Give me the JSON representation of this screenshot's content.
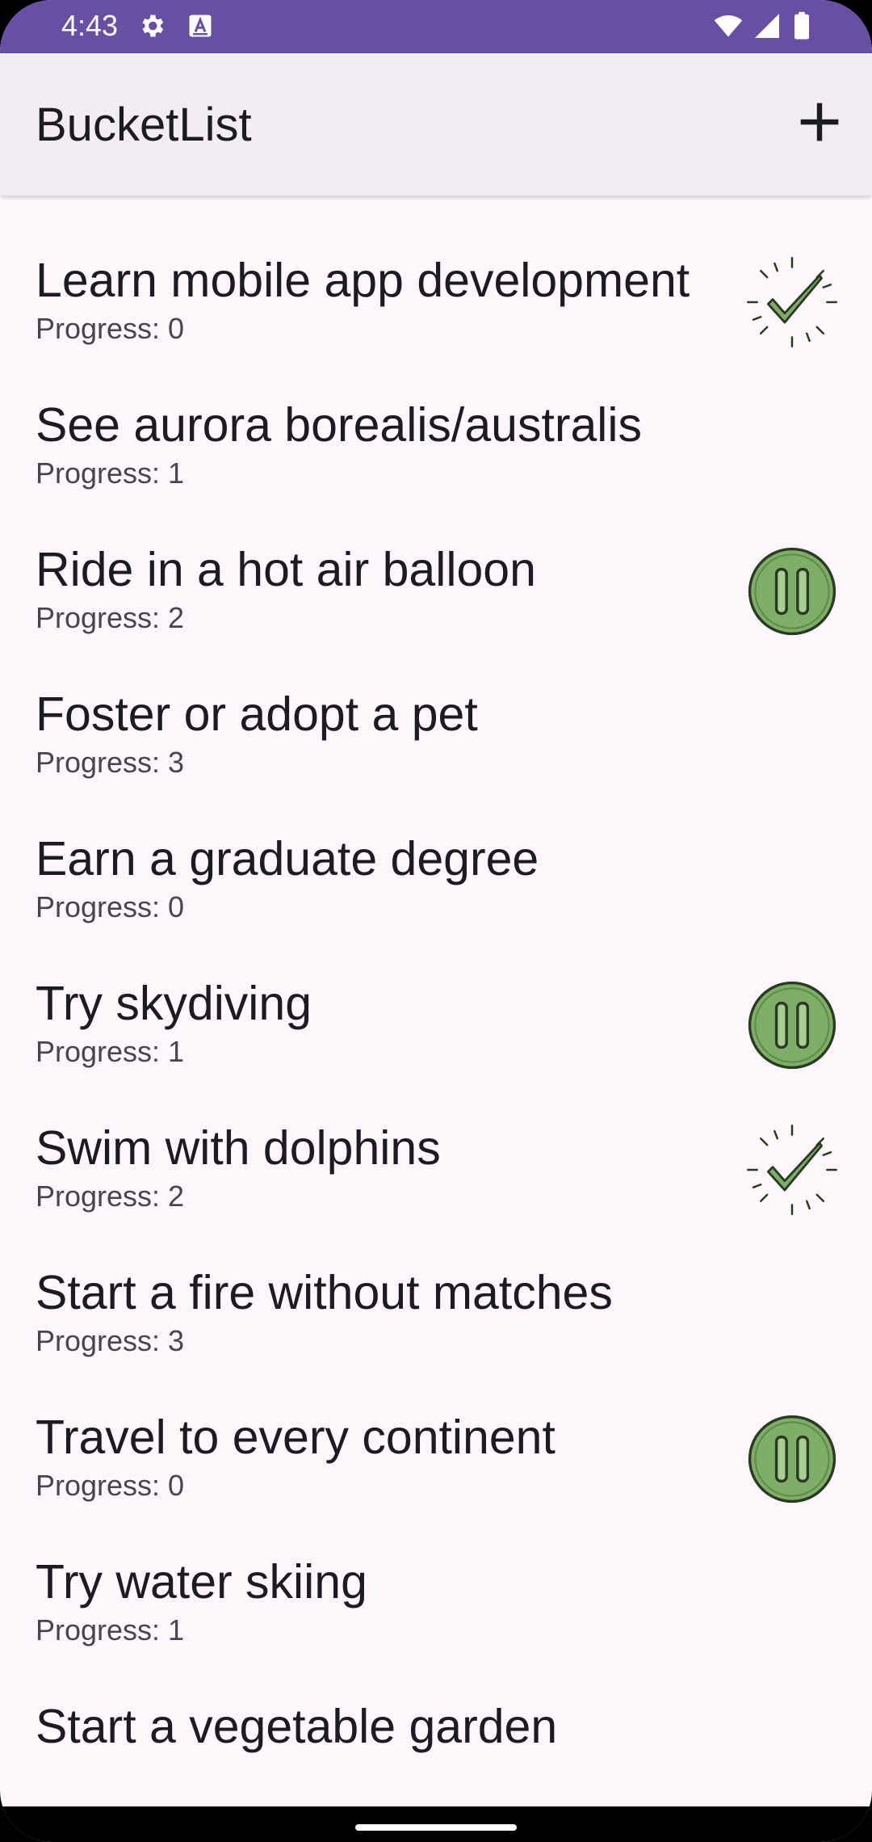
{
  "status_bar": {
    "time": "4:43",
    "left_icons": [
      "gear-icon",
      "text-a-icon"
    ],
    "right_icons": [
      "wifi-icon",
      "signal-icon",
      "battery-icon"
    ],
    "background": "#6750a4"
  },
  "app_bar": {
    "title": "BucketList",
    "action_icon": "plus-icon"
  },
  "items": [
    {
      "title": "Learn mobile app development",
      "progress_label": "Progress: 0",
      "status_icon": "check-sparkle-icon"
    },
    {
      "title": "See aurora borealis/australis",
      "progress_label": "Progress: 1",
      "status_icon": ""
    },
    {
      "title": "Ride in a hot air balloon",
      "progress_label": "Progress: 2",
      "status_icon": "pause-circle-icon"
    },
    {
      "title": "Foster or adopt a pet",
      "progress_label": "Progress: 3",
      "status_icon": ""
    },
    {
      "title": "Earn a graduate degree",
      "progress_label": "Progress: 0",
      "status_icon": ""
    },
    {
      "title": "Try skydiving",
      "progress_label": "Progress: 1",
      "status_icon": "pause-circle-icon"
    },
    {
      "title": "Swim with dolphins",
      "progress_label": "Progress: 2",
      "status_icon": "check-sparkle-icon"
    },
    {
      "title": "Start a fire without matches",
      "progress_label": "Progress: 3",
      "status_icon": ""
    },
    {
      "title": "Travel to every continent",
      "progress_label": "Progress: 0",
      "status_icon": "pause-circle-icon"
    },
    {
      "title": "Try water skiing",
      "progress_label": "Progress: 1",
      "status_icon": ""
    },
    {
      "title": "Start a vegetable garden",
      "progress_label": "",
      "status_icon": ""
    }
  ],
  "colors": {
    "accent": "#6750a4",
    "surface": "#fdf7fc",
    "app_bar": "#f2edf5",
    "icon_green": "#7fae67",
    "icon_dark": "#2b3a25"
  }
}
